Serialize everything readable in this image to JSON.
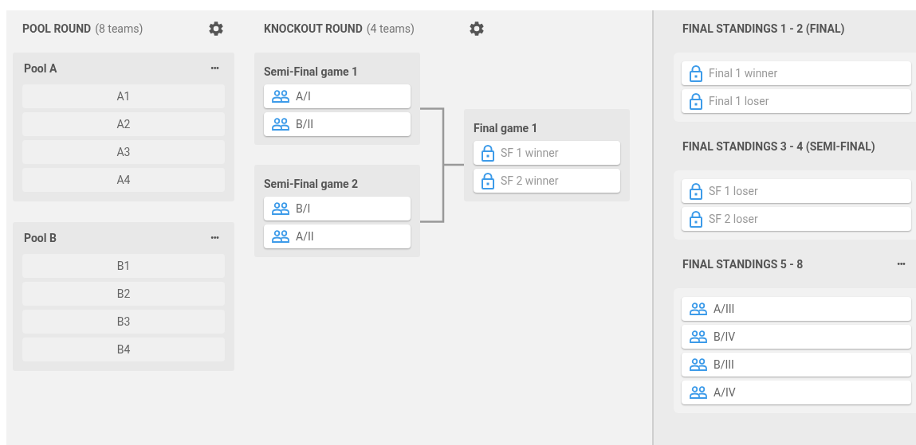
{
  "pool_round": {
    "title": "POOL ROUND",
    "count": "(8 teams)",
    "pools": [
      {
        "name": "Pool A",
        "menu": "•••",
        "teams": [
          "A1",
          "A2",
          "A3",
          "A4"
        ]
      },
      {
        "name": "Pool B",
        "menu": "•••",
        "teams": [
          "B1",
          "B2",
          "B3",
          "B4"
        ]
      }
    ]
  },
  "knockout_round": {
    "title": "KNOCKOUT ROUND",
    "count": "(4 teams)",
    "semi_finals": [
      {
        "name": "Semi-Final game 1",
        "slots": [
          {
            "kind": "team",
            "label": "A/I"
          },
          {
            "kind": "team",
            "label": "B/II"
          }
        ]
      },
      {
        "name": "Semi-Final game 2",
        "slots": [
          {
            "kind": "team",
            "label": "B/I"
          },
          {
            "kind": "team",
            "label": "A/II"
          }
        ]
      }
    ],
    "final": {
      "name": "Final game 1",
      "slots": [
        {
          "kind": "locked",
          "label": "SF 1 winner"
        },
        {
          "kind": "locked",
          "label": "SF 2 winner"
        }
      ]
    }
  },
  "standings": [
    {
      "title": "FINAL STANDINGS 1 - 2 (FINAL)",
      "slots": [
        {
          "kind": "locked",
          "label": "Final 1 winner"
        },
        {
          "kind": "locked",
          "label": "Final 1 loser"
        }
      ]
    },
    {
      "title": "FINAL STANDINGS 3 - 4 (SEMI-FINAL)",
      "slots": [
        {
          "kind": "locked",
          "label": "SF 1 loser"
        },
        {
          "kind": "locked",
          "label": "SF 2 loser"
        }
      ]
    },
    {
      "title": "FINAL STANDINGS 5 - 8",
      "menu": "•••",
      "slots": [
        {
          "kind": "team",
          "label": "A/III"
        },
        {
          "kind": "team",
          "label": "B/IV"
        },
        {
          "kind": "team",
          "label": "B/III"
        },
        {
          "kind": "team",
          "label": "A/IV"
        }
      ]
    }
  ]
}
